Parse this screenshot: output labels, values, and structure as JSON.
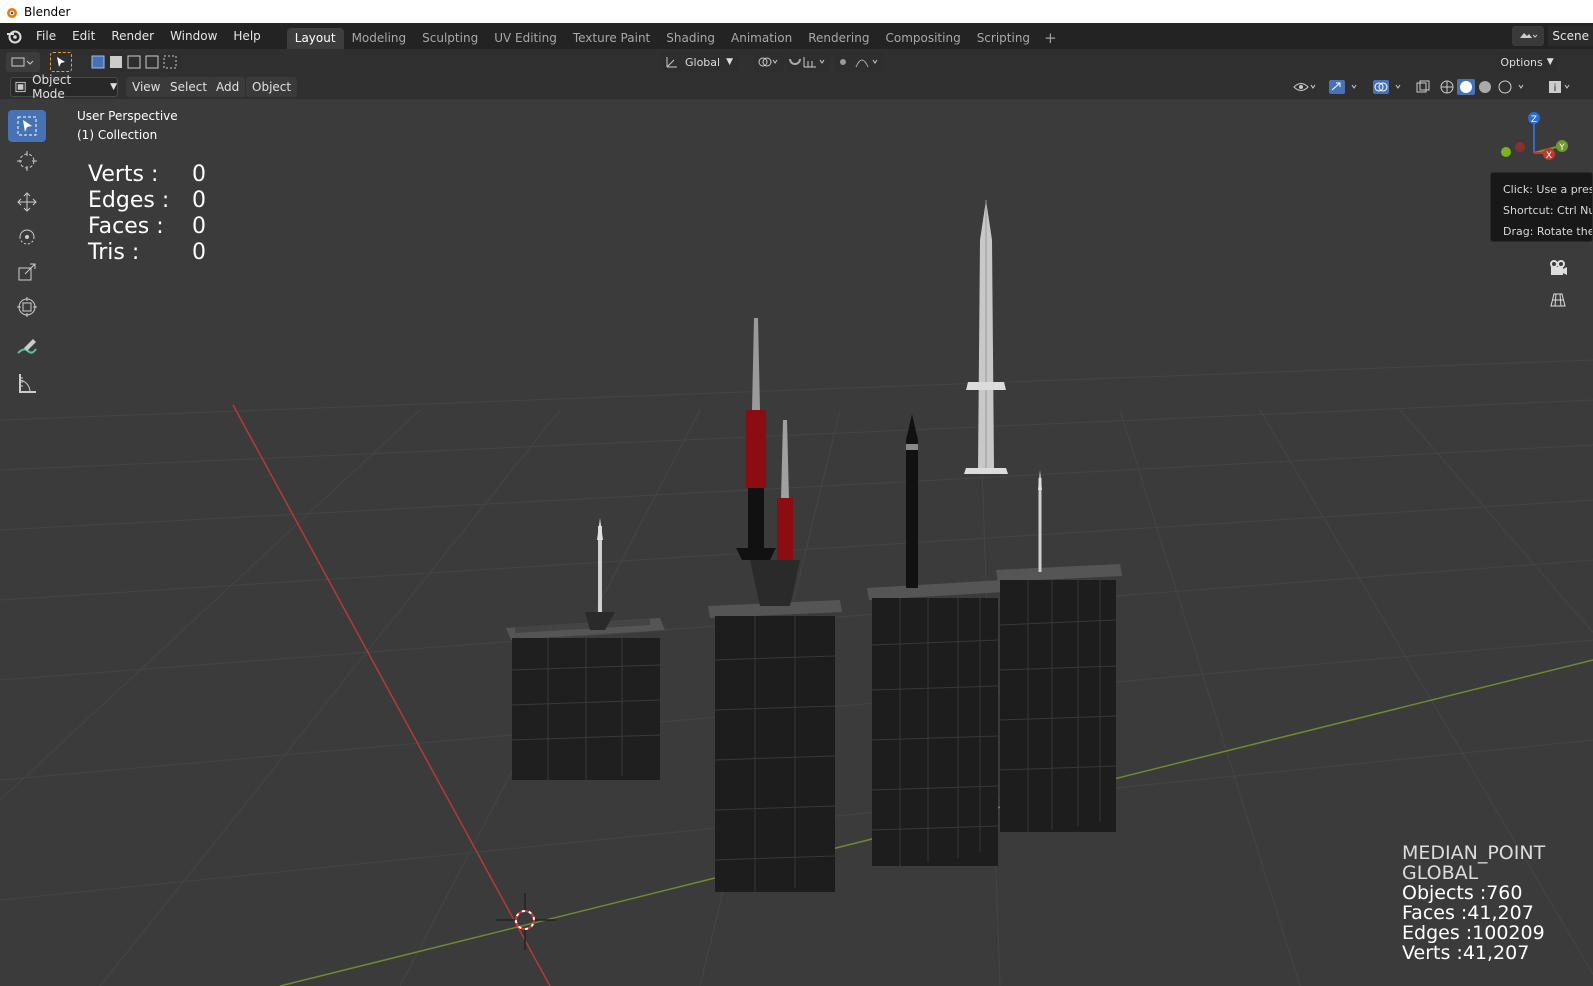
{
  "window": {
    "title": "Blender"
  },
  "menubar": {
    "items": [
      "File",
      "Edit",
      "Render",
      "Window",
      "Help"
    ],
    "workspaces": [
      "Layout",
      "Modeling",
      "Sculpting",
      "UV Editing",
      "Texture Paint",
      "Shading",
      "Animation",
      "Rendering",
      "Compositing",
      "Scripting"
    ],
    "active_workspace": "Layout",
    "scene_label": "Scene"
  },
  "tool_header": {
    "orientation": "Global",
    "options_label": "Options"
  },
  "viewport_header": {
    "mode": "Object Mode",
    "menus": [
      "View",
      "Select",
      "Add",
      "Object"
    ]
  },
  "viewport": {
    "perspective_label": "User Perspective",
    "collection_label": "(1) Collection",
    "stats": {
      "verts_label": "Verts :",
      "verts_value": "0",
      "edges_label": "Edges :",
      "edges_value": "0",
      "faces_label": "Faces :",
      "faces_value": "0",
      "tris_label": "Tris :",
      "tris_value": "0"
    },
    "bottom_right": {
      "pivot": "MEDIAN_POINT",
      "orientation": "GLOBAL",
      "objects": "Objects :760",
      "faces": "Faces :41,207",
      "edges": "Edges :100209",
      "verts": "Verts :41,207"
    },
    "tooltip": {
      "line1": "Click: Use a preset",
      "line2": "Shortcut: Ctrl Num",
      "line3": "Drag: Rotate the v"
    },
    "gizmo_axes": [
      "Z",
      "Y",
      "X"
    ]
  },
  "toolbar_icons": [
    "select-box-icon",
    "cursor-icon",
    "move-icon",
    "rotate-icon",
    "scale-icon",
    "transform-icon",
    "annotate-icon",
    "measure-icon"
  ],
  "colors": {
    "accent": "#4772b3",
    "x_axis": "#c0392b",
    "y_axis": "#6e9a2a",
    "z_axis": "#2a6cd4",
    "missile_red": "#8b0d12"
  }
}
